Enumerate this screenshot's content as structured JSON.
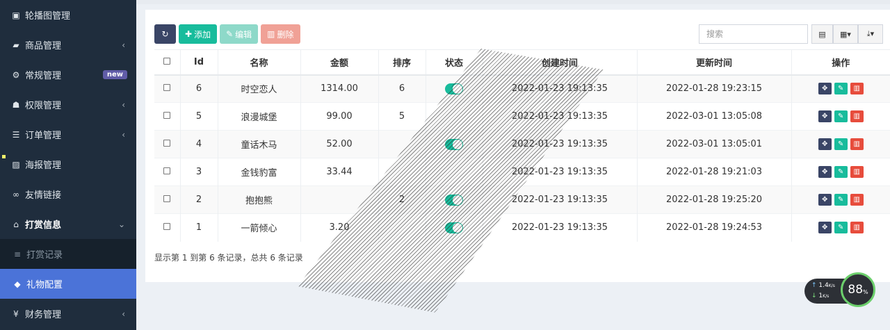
{
  "sidebar": {
    "items": [
      {
        "label": "轮播图管理",
        "icon": "image-icon",
        "chevron": ""
      },
      {
        "label": "商品管理",
        "icon": "book-icon",
        "chevron": "‹"
      },
      {
        "label": "常规管理",
        "icon": "cogs-icon",
        "badge": "new"
      },
      {
        "label": "权限管理",
        "icon": "users-icon",
        "chevron": "‹"
      },
      {
        "label": "订单管理",
        "icon": "list-icon",
        "chevron": "‹"
      },
      {
        "label": "海报管理",
        "icon": "picture-icon",
        "chevron": ""
      },
      {
        "label": "友情链接",
        "icon": "link-icon",
        "chevron": ""
      },
      {
        "label": "打赏信息",
        "icon": "gift-icon",
        "chevron": "⌄"
      },
      {
        "label": "打赏记录",
        "icon": "bars-icon"
      },
      {
        "label": "礼物配置",
        "icon": "cube-icon"
      },
      {
        "label": "财务管理",
        "icon": "yen-icon",
        "chevron": "‹"
      }
    ]
  },
  "toolbar": {
    "add_label": "添加",
    "edit_label": "编辑",
    "delete_label": "删除",
    "search_placeholder": "搜索"
  },
  "table": {
    "headers": [
      "Id",
      "名称",
      "金额",
      "排序",
      "状态",
      "创建时间",
      "更新时间",
      "操作"
    ],
    "rows": [
      {
        "id": "6",
        "name": "时空恋人",
        "amount": "1314.00",
        "sort": "6",
        "status": true,
        "created": "2022-01-23 19:13:35",
        "updated": "2022-01-28 19:23:15"
      },
      {
        "id": "5",
        "name": "浪漫城堡",
        "amount": "99.00",
        "sort": "5",
        "status": false,
        "created": "2022-01-23 19:13:35",
        "updated": "2022-03-01 13:05:08"
      },
      {
        "id": "4",
        "name": "童话木马",
        "amount": "52.00",
        "sort": "",
        "status": true,
        "created": "2022-01-23 19:13:35",
        "updated": "2022-03-01 13:05:01"
      },
      {
        "id": "3",
        "name": "金钱豹富",
        "amount": "33.44",
        "sort": "",
        "status": false,
        "created": "2022-01-23 19:13:35",
        "updated": "2022-01-28 19:21:03"
      },
      {
        "id": "2",
        "name": "抱抱熊",
        "amount": "",
        "sort": "2",
        "status": true,
        "created": "2022-01-23 19:13:35",
        "updated": "2022-01-28 19:25:20"
      },
      {
        "id": "1",
        "name": "一箭倾心",
        "amount": "3.20",
        "sort": "",
        "status": true,
        "created": "2022-01-23 19:13:35",
        "updated": "2022-01-28 19:24:53"
      }
    ]
  },
  "pager": {
    "text": "显示第 1 到第 6 条记录，总共 6 条记录"
  },
  "net_widget": {
    "up": "1.4",
    "up_unit": "K/s",
    "down": "1",
    "down_unit": "K/s",
    "percent": "88",
    "percent_unit": "%"
  }
}
